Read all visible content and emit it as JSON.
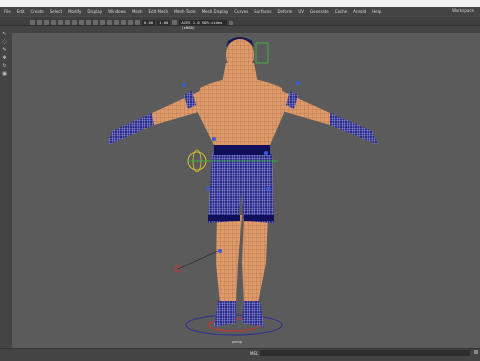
{
  "app": {
    "workspace_label": "Workspace"
  },
  "menubar": {
    "items": [
      "File",
      "Edit",
      "Create",
      "Select",
      "Modify",
      "Display",
      "Windows",
      "Mesh",
      "Edit Mesh",
      "Mesh Tools",
      "Mesh Display",
      "Curves",
      "Surfaces",
      "Deform",
      "UV",
      "Generate",
      "Cache",
      "Arnold",
      "Help"
    ]
  },
  "panel_menu": {
    "items": [
      "View",
      "Shading",
      "Lighting",
      "Show",
      "Renderer",
      "Panels"
    ]
  },
  "toolbar": {
    "field_a": "0.00",
    "field_b": "1.00",
    "color_space": "ACES 1.0 SDR-video (sRGB)"
  },
  "left_tools": {
    "items": [
      "arrow",
      "lasso",
      "paint",
      "move",
      "rotate",
      "scale"
    ]
  },
  "viewport": {
    "camera_label": "persp"
  },
  "command_line": {
    "label": "MEL"
  }
}
